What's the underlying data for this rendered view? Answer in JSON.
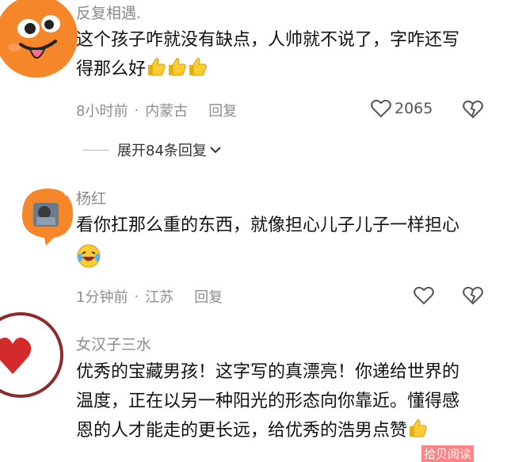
{
  "comments": [
    {
      "name": "反复相遇.",
      "lines": [
        "这个孩子咋就没有缺点，人帅就不说了，字咋还写",
        "得那么好"
      ],
      "emoji_count": 3,
      "time": "8小时前",
      "location": "内蒙古",
      "reply": "回复",
      "likes": "2065"
    },
    {
      "name": "杨红",
      "lines": [
        "看你扛那么重的东西，就像担心儿子儿子一样担心"
      ],
      "time": "1分钟前",
      "location": "江苏",
      "reply": "回复"
    },
    {
      "name": "女汉子三水",
      "lines": [
        "优秀的宝藏男孩！这字写的真漂亮！你递给世界的",
        "温度，正在以另一种阳光的形态向你靠近。懂得感",
        "恩的人才能走的更长远，给优秀的浩男点赞"
      ]
    }
  ],
  "expand_replies": "展开84条回复",
  "watermark": "拾贝阅读",
  "colors": {
    "avatar_orange": "#f5862a",
    "heart_red": "#d32b2b",
    "ring_brown": "#8b2b2b"
  }
}
